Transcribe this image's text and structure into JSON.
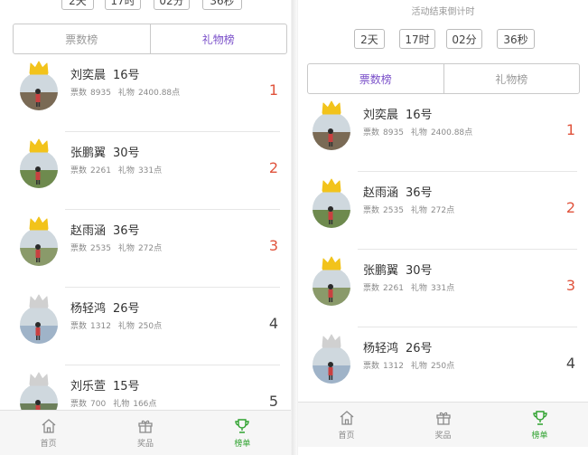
{
  "left": {
    "countdown_partial": [
      "2天",
      "17时",
      "02分",
      "36秒"
    ],
    "tabs": [
      {
        "label": "票数榜",
        "active": false
      },
      {
        "label": "礼物榜",
        "active": true
      }
    ],
    "entries": [
      {
        "name": "刘奕晨",
        "number": "16号",
        "votes_label": "票数",
        "votes": "8935",
        "gifts_label": "礼物",
        "gifts": "2400.88点",
        "rank": "1",
        "crown": "gold"
      },
      {
        "name": "张鹏翼",
        "number": "30号",
        "votes_label": "票数",
        "votes": "2261",
        "gifts_label": "礼物",
        "gifts": "331点",
        "rank": "2",
        "crown": "gold"
      },
      {
        "name": "赵雨涵",
        "number": "36号",
        "votes_label": "票数",
        "votes": "2535",
        "gifts_label": "礼物",
        "gifts": "272点",
        "rank": "3",
        "crown": "gold"
      },
      {
        "name": "杨轻鸿",
        "number": "26号",
        "votes_label": "票数",
        "votes": "1312",
        "gifts_label": "礼物",
        "gifts": "250点",
        "rank": "4",
        "crown": "silver"
      },
      {
        "name": "刘乐萱",
        "number": "15号",
        "votes_label": "票数",
        "votes": "700",
        "gifts_label": "礼物",
        "gifts": "166点",
        "rank": "5",
        "crown": "silver"
      }
    ],
    "nav": [
      {
        "label": "首页",
        "icon": "home-icon",
        "active": false
      },
      {
        "label": "奖品",
        "icon": "gift-icon",
        "active": false
      },
      {
        "label": "榜单",
        "icon": "trophy-icon",
        "active": true
      }
    ]
  },
  "right": {
    "countdown_title": "活动结束倒计时",
    "countdown": [
      "2天",
      "17时",
      "02分",
      "36秒"
    ],
    "tabs": [
      {
        "label": "票数榜",
        "active": true
      },
      {
        "label": "礼物榜",
        "active": false
      }
    ],
    "entries": [
      {
        "name": "刘奕晨",
        "number": "16号",
        "votes_label": "票数",
        "votes": "8935",
        "gifts_label": "礼物",
        "gifts": "2400.88点",
        "rank": "1",
        "crown": "gold"
      },
      {
        "name": "赵雨涵",
        "number": "36号",
        "votes_label": "票数",
        "votes": "2535",
        "gifts_label": "礼物",
        "gifts": "272点",
        "rank": "2",
        "crown": "gold"
      },
      {
        "name": "张鹏翼",
        "number": "30号",
        "votes_label": "票数",
        "votes": "2261",
        "gifts_label": "礼物",
        "gifts": "331点",
        "rank": "3",
        "crown": "gold"
      },
      {
        "name": "杨轻鸿",
        "number": "26号",
        "votes_label": "票数",
        "votes": "1312",
        "gifts_label": "礼物",
        "gifts": "250点",
        "rank": "4",
        "crown": "silver"
      }
    ],
    "nav": [
      {
        "label": "首页",
        "icon": "home-icon",
        "active": false
      },
      {
        "label": "奖品",
        "icon": "gift-icon",
        "active": false
      },
      {
        "label": "榜单",
        "icon": "trophy-icon",
        "active": true
      }
    ]
  },
  "colors": {
    "accent_purple": "#7a4fc9",
    "rank_red": "#e0533c",
    "nav_active_green": "#2fa22f",
    "crown_gold": "#f2c31b",
    "crown_silver": "#d0d0d0"
  }
}
